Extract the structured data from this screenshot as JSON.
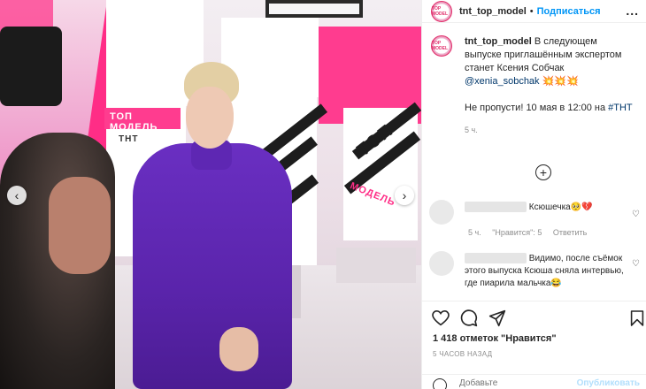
{
  "post": {
    "username": "tnt_top_model",
    "follow_label": "Подписаться",
    "more_label": "...",
    "avatar_text": "TOP MODEL",
    "caption_line1": "В следующем выпуске приглашённым экспертом станет Ксения Собчак",
    "caption_mention": "@xenia_sobchak",
    "caption_emojis": "💥💥💥",
    "caption_line2_a": "Не пропусти! 10 мая в 12:00 на ",
    "caption_hashtag": "#ТНТ",
    "caption_time": "5 ч."
  },
  "photo": {
    "logo_tnt": "ТНТ",
    "logo_top": "ТОП",
    "logo_model": "МОДЕЛЬ",
    "logo_topmodel_small": "ТОП МОДЕЛЬ"
  },
  "comments": [
    {
      "text": "Ксюшечка🥺💔",
      "time": "5 ч.",
      "likes": "\"Нравится\": 5",
      "reply": "Ответить"
    },
    {
      "text": "Видимо, после съёмок этого выпуска Ксюша сняла интервью, где пиарила мальчка😂"
    }
  ],
  "icons": {
    "like": "heart-icon",
    "comment": "comment-icon",
    "share": "share-icon",
    "save": "bookmark-icon",
    "load_more": "plus-icon",
    "emoji": "emoji-icon",
    "nav_prev": "chevron-left-icon",
    "nav_next": "chevron-right-icon"
  },
  "footer": {
    "likes": "1 418 отметок \"Нравится\"",
    "ago": "5 ЧАСОВ НАЗАД",
    "add_placeholder": "Добавьте",
    "publish_label": "Опубликовать"
  }
}
